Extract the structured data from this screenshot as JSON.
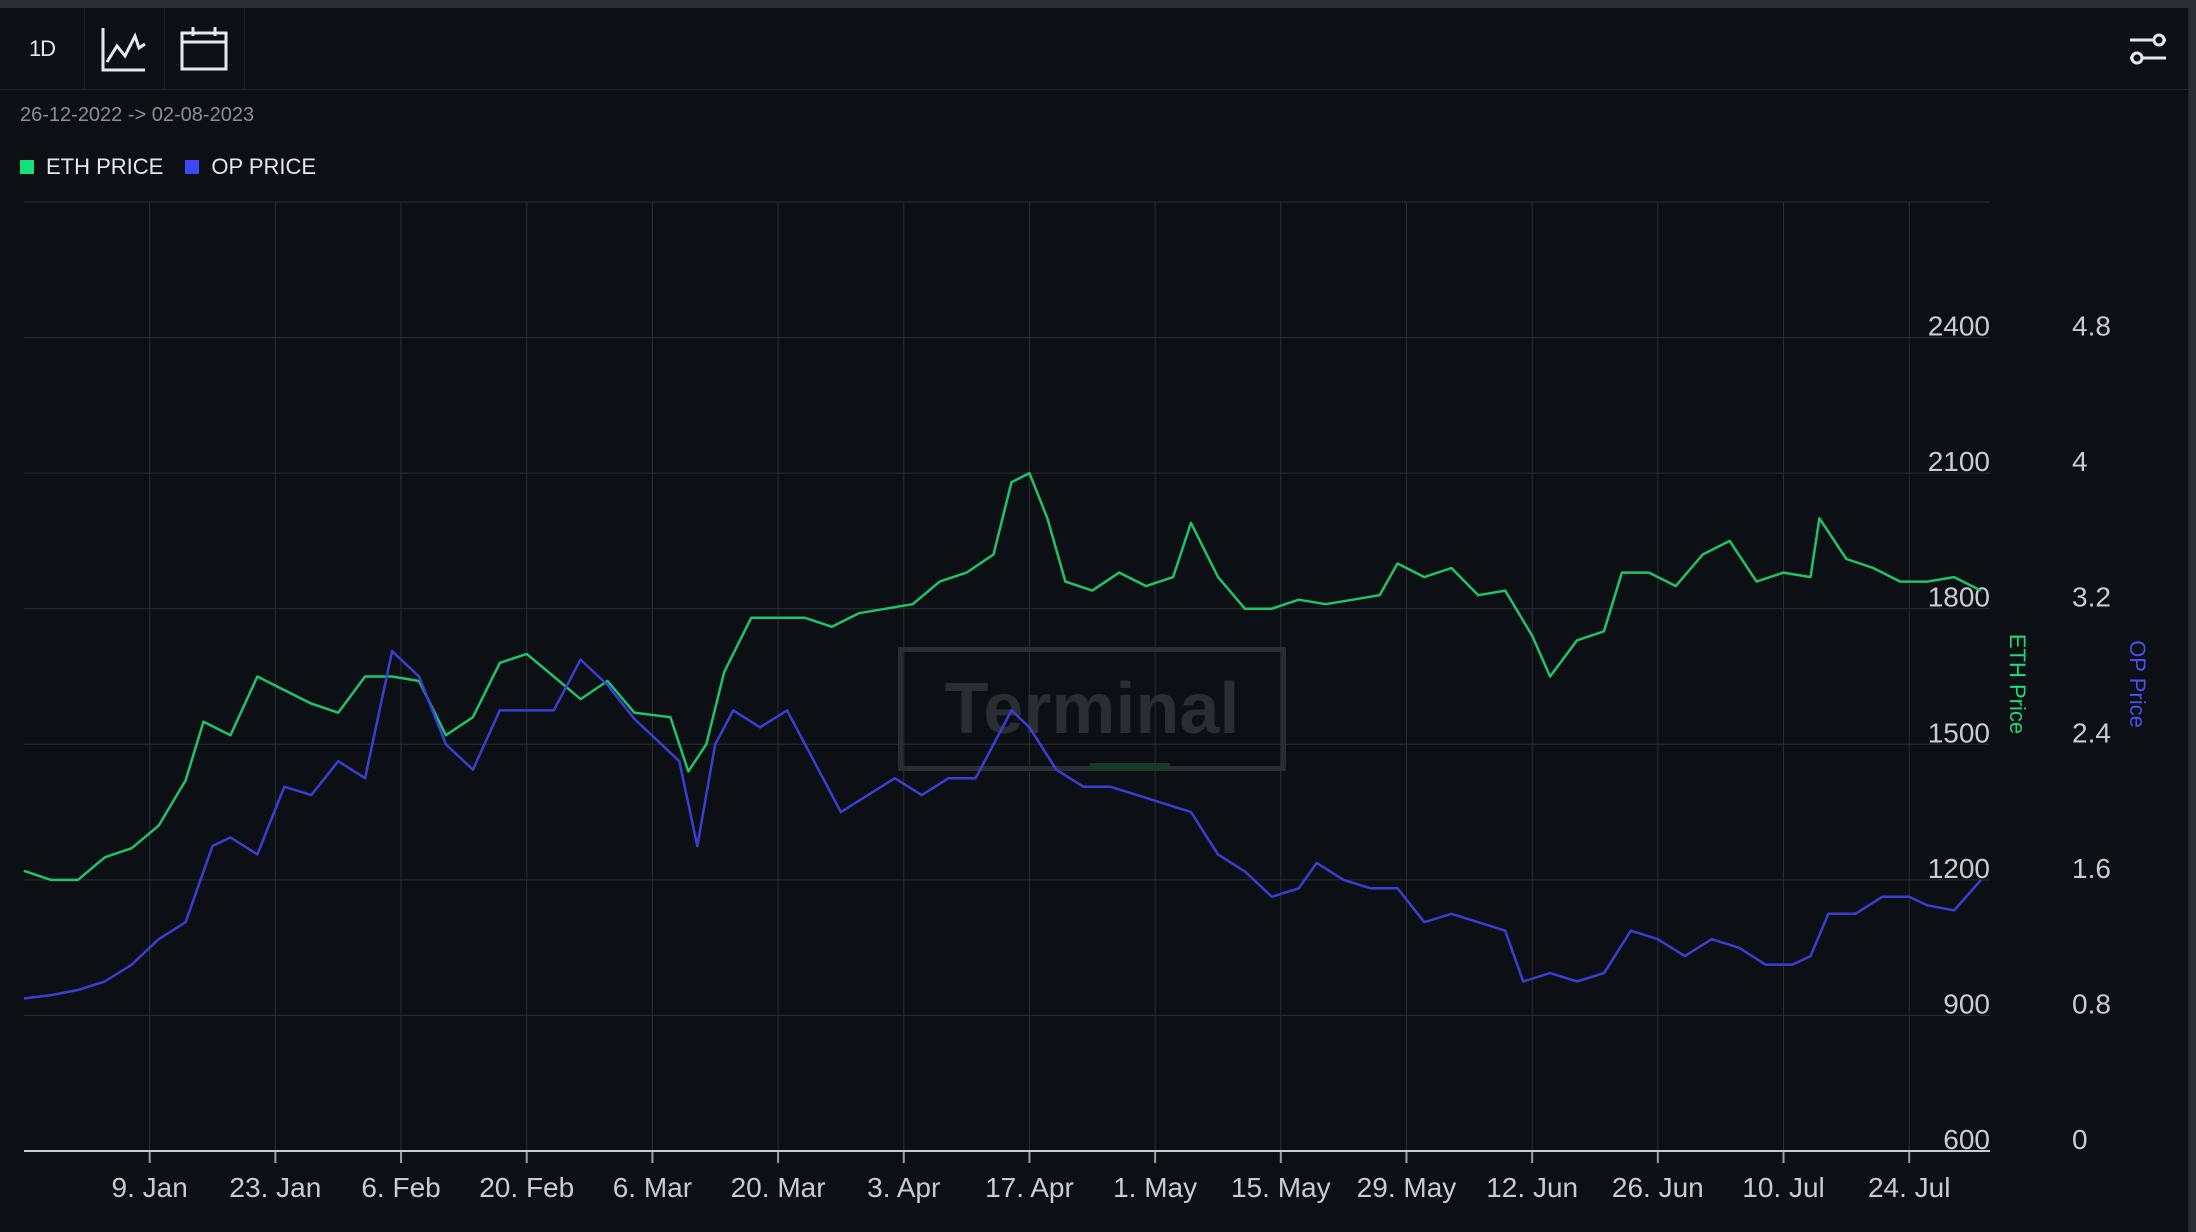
{
  "toolbar": {
    "interval_label": "1D",
    "line_chart_icon": "line-chart-icon",
    "calendar_icon": "calendar-icon",
    "settings_icon": "sliders-icon"
  },
  "date_range": "26-12-2022 -> 02-08-2023",
  "watermark": "Terminal",
  "colors": {
    "background": "#0c0f14",
    "grid": "#2b2f36",
    "eth": "#1fc46a",
    "op": "#3a3fd4",
    "eth_swatch": "#16e07a",
    "op_swatch": "#3f46ff",
    "eth_axis_label": "#1fd877",
    "op_axis_label": "#4a4ff0"
  },
  "chart_data": {
    "type": "line",
    "legend": [
      {
        "label": "ETH PRICE",
        "color": "#16e07a"
      },
      {
        "label": "OP PRICE",
        "color": "#3f46ff"
      }
    ],
    "x_range": [
      "2022-12-26",
      "2023-08-02"
    ],
    "x_ticks": [
      {
        "date": "2023-01-09",
        "label": "9. Jan"
      },
      {
        "date": "2023-01-23",
        "label": "23. Jan"
      },
      {
        "date": "2023-02-06",
        "label": "6. Feb"
      },
      {
        "date": "2023-02-20",
        "label": "20. Feb"
      },
      {
        "date": "2023-03-06",
        "label": "6. Mar"
      },
      {
        "date": "2023-03-20",
        "label": "20. Mar"
      },
      {
        "date": "2023-04-03",
        "label": "3. Apr"
      },
      {
        "date": "2023-04-17",
        "label": "17. Apr"
      },
      {
        "date": "2023-05-01",
        "label": "1. May"
      },
      {
        "date": "2023-05-15",
        "label": "15. May"
      },
      {
        "date": "2023-05-29",
        "label": "29. May"
      },
      {
        "date": "2023-06-12",
        "label": "12. Jun"
      },
      {
        "date": "2023-06-26",
        "label": "26. Jun"
      },
      {
        "date": "2023-07-10",
        "label": "10. Jul"
      },
      {
        "date": "2023-07-24",
        "label": "24. Jul"
      }
    ],
    "y_axes": [
      {
        "label": "ETH Price",
        "range": [
          600,
          2700
        ],
        "ticks": [
          "600",
          "900",
          "1200",
          "1500",
          "1800",
          "2100",
          "2400"
        ]
      },
      {
        "label": "OP Price",
        "range": [
          0,
          5.6
        ],
        "ticks": [
          "0",
          "0.8",
          "1.6",
          "2.4",
          "3.2",
          "4",
          "4.8"
        ]
      }
    ],
    "series": [
      {
        "name": "ETH PRICE",
        "axis": 0,
        "points": [
          [
            "2022-12-26",
            1220
          ],
          [
            "2022-12-29",
            1200
          ],
          [
            "2023-01-01",
            1200
          ],
          [
            "2023-01-04",
            1250
          ],
          [
            "2023-01-07",
            1270
          ],
          [
            "2023-01-10",
            1320
          ],
          [
            "2023-01-13",
            1420
          ],
          [
            "2023-01-15",
            1550
          ],
          [
            "2023-01-18",
            1520
          ],
          [
            "2023-01-21",
            1650
          ],
          [
            "2023-01-24",
            1620
          ],
          [
            "2023-01-27",
            1590
          ],
          [
            "2023-01-30",
            1570
          ],
          [
            "2023-02-02",
            1650
          ],
          [
            "2023-02-05",
            1650
          ],
          [
            "2023-02-08",
            1640
          ],
          [
            "2023-02-11",
            1520
          ],
          [
            "2023-02-14",
            1560
          ],
          [
            "2023-02-17",
            1680
          ],
          [
            "2023-02-20",
            1700
          ],
          [
            "2023-02-23",
            1650
          ],
          [
            "2023-02-26",
            1600
          ],
          [
            "2023-03-01",
            1640
          ],
          [
            "2023-03-04",
            1570
          ],
          [
            "2023-03-08",
            1560
          ],
          [
            "2023-03-10",
            1440
          ],
          [
            "2023-03-12",
            1500
          ],
          [
            "2023-03-14",
            1660
          ],
          [
            "2023-03-17",
            1780
          ],
          [
            "2023-03-20",
            1780
          ],
          [
            "2023-03-23",
            1780
          ],
          [
            "2023-03-26",
            1760
          ],
          [
            "2023-03-29",
            1790
          ],
          [
            "2023-04-01",
            1800
          ],
          [
            "2023-04-04",
            1810
          ],
          [
            "2023-04-07",
            1860
          ],
          [
            "2023-04-10",
            1880
          ],
          [
            "2023-04-13",
            1920
          ],
          [
            "2023-04-15",
            2080
          ],
          [
            "2023-04-17",
            2100
          ],
          [
            "2023-04-19",
            2000
          ],
          [
            "2023-04-21",
            1860
          ],
          [
            "2023-04-24",
            1840
          ],
          [
            "2023-04-27",
            1880
          ],
          [
            "2023-04-30",
            1850
          ],
          [
            "2023-05-03",
            1870
          ],
          [
            "2023-05-05",
            1990
          ],
          [
            "2023-05-08",
            1870
          ],
          [
            "2023-05-11",
            1800
          ],
          [
            "2023-05-14",
            1800
          ],
          [
            "2023-05-17",
            1820
          ],
          [
            "2023-05-20",
            1810
          ],
          [
            "2023-05-23",
            1820
          ],
          [
            "2023-05-26",
            1830
          ],
          [
            "2023-05-28",
            1900
          ],
          [
            "2023-05-31",
            1870
          ],
          [
            "2023-06-03",
            1890
          ],
          [
            "2023-06-06",
            1830
          ],
          [
            "2023-06-09",
            1840
          ],
          [
            "2023-06-12",
            1740
          ],
          [
            "2023-06-14",
            1650
          ],
          [
            "2023-06-17",
            1730
          ],
          [
            "2023-06-20",
            1750
          ],
          [
            "2023-06-22",
            1880
          ],
          [
            "2023-06-25",
            1880
          ],
          [
            "2023-06-28",
            1850
          ],
          [
            "2023-07-01",
            1920
          ],
          [
            "2023-07-04",
            1950
          ],
          [
            "2023-07-07",
            1860
          ],
          [
            "2023-07-10",
            1880
          ],
          [
            "2023-07-13",
            1870
          ],
          [
            "2023-07-14",
            2000
          ],
          [
            "2023-07-17",
            1910
          ],
          [
            "2023-07-20",
            1890
          ],
          [
            "2023-07-23",
            1860
          ],
          [
            "2023-07-26",
            1860
          ],
          [
            "2023-07-29",
            1870
          ],
          [
            "2023-08-01",
            1840
          ]
        ]
      },
      {
        "name": "OP PRICE",
        "axis": 1,
        "points": [
          [
            "2022-12-26",
            0.9
          ],
          [
            "2022-12-29",
            0.92
          ],
          [
            "2023-01-01",
            0.95
          ],
          [
            "2023-01-04",
            1.0
          ],
          [
            "2023-01-07",
            1.1
          ],
          [
            "2023-01-10",
            1.25
          ],
          [
            "2023-01-13",
            1.35
          ],
          [
            "2023-01-16",
            1.8
          ],
          [
            "2023-01-18",
            1.85
          ],
          [
            "2023-01-21",
            1.75
          ],
          [
            "2023-01-24",
            2.15
          ],
          [
            "2023-01-27",
            2.1
          ],
          [
            "2023-01-30",
            2.3
          ],
          [
            "2023-02-02",
            2.2
          ],
          [
            "2023-02-05",
            2.95
          ],
          [
            "2023-02-08",
            2.8
          ],
          [
            "2023-02-11",
            2.4
          ],
          [
            "2023-02-14",
            2.25
          ],
          [
            "2023-02-17",
            2.6
          ],
          [
            "2023-02-20",
            2.6
          ],
          [
            "2023-02-23",
            2.6
          ],
          [
            "2023-02-26",
            2.9
          ],
          [
            "2023-03-01",
            2.75
          ],
          [
            "2023-03-04",
            2.55
          ],
          [
            "2023-03-07",
            2.4
          ],
          [
            "2023-03-09",
            2.3
          ],
          [
            "2023-03-11",
            1.8
          ],
          [
            "2023-03-13",
            2.4
          ],
          [
            "2023-03-15",
            2.6
          ],
          [
            "2023-03-18",
            2.5
          ],
          [
            "2023-03-21",
            2.6
          ],
          [
            "2023-03-24",
            2.3
          ],
          [
            "2023-03-27",
            2.0
          ],
          [
            "2023-03-30",
            2.1
          ],
          [
            "2023-04-02",
            2.2
          ],
          [
            "2023-04-05",
            2.1
          ],
          [
            "2023-04-08",
            2.2
          ],
          [
            "2023-04-11",
            2.2
          ],
          [
            "2023-04-15",
            2.6
          ],
          [
            "2023-04-17",
            2.5
          ],
          [
            "2023-04-20",
            2.25
          ],
          [
            "2023-04-23",
            2.15
          ],
          [
            "2023-04-26",
            2.15
          ],
          [
            "2023-04-29",
            2.1
          ],
          [
            "2023-05-02",
            2.05
          ],
          [
            "2023-05-05",
            2.0
          ],
          [
            "2023-05-08",
            1.75
          ],
          [
            "2023-05-11",
            1.65
          ],
          [
            "2023-05-14",
            1.5
          ],
          [
            "2023-05-17",
            1.55
          ],
          [
            "2023-05-19",
            1.7
          ],
          [
            "2023-05-22",
            1.6
          ],
          [
            "2023-05-25",
            1.55
          ],
          [
            "2023-05-28",
            1.55
          ],
          [
            "2023-05-31",
            1.35
          ],
          [
            "2023-06-03",
            1.4
          ],
          [
            "2023-06-06",
            1.35
          ],
          [
            "2023-06-09",
            1.3
          ],
          [
            "2023-06-11",
            1.0
          ],
          [
            "2023-06-14",
            1.05
          ],
          [
            "2023-06-17",
            1.0
          ],
          [
            "2023-06-20",
            1.05
          ],
          [
            "2023-06-23",
            1.3
          ],
          [
            "2023-06-26",
            1.25
          ],
          [
            "2023-06-29",
            1.15
          ],
          [
            "2023-07-02",
            1.25
          ],
          [
            "2023-07-05",
            1.2
          ],
          [
            "2023-07-08",
            1.1
          ],
          [
            "2023-07-11",
            1.1
          ],
          [
            "2023-07-13",
            1.15
          ],
          [
            "2023-07-15",
            1.4
          ],
          [
            "2023-07-18",
            1.4
          ],
          [
            "2023-07-21",
            1.5
          ],
          [
            "2023-07-24",
            1.5
          ],
          [
            "2023-07-26",
            1.45
          ],
          [
            "2023-07-29",
            1.42
          ],
          [
            "2023-08-01",
            1.6
          ]
        ]
      }
    ]
  }
}
